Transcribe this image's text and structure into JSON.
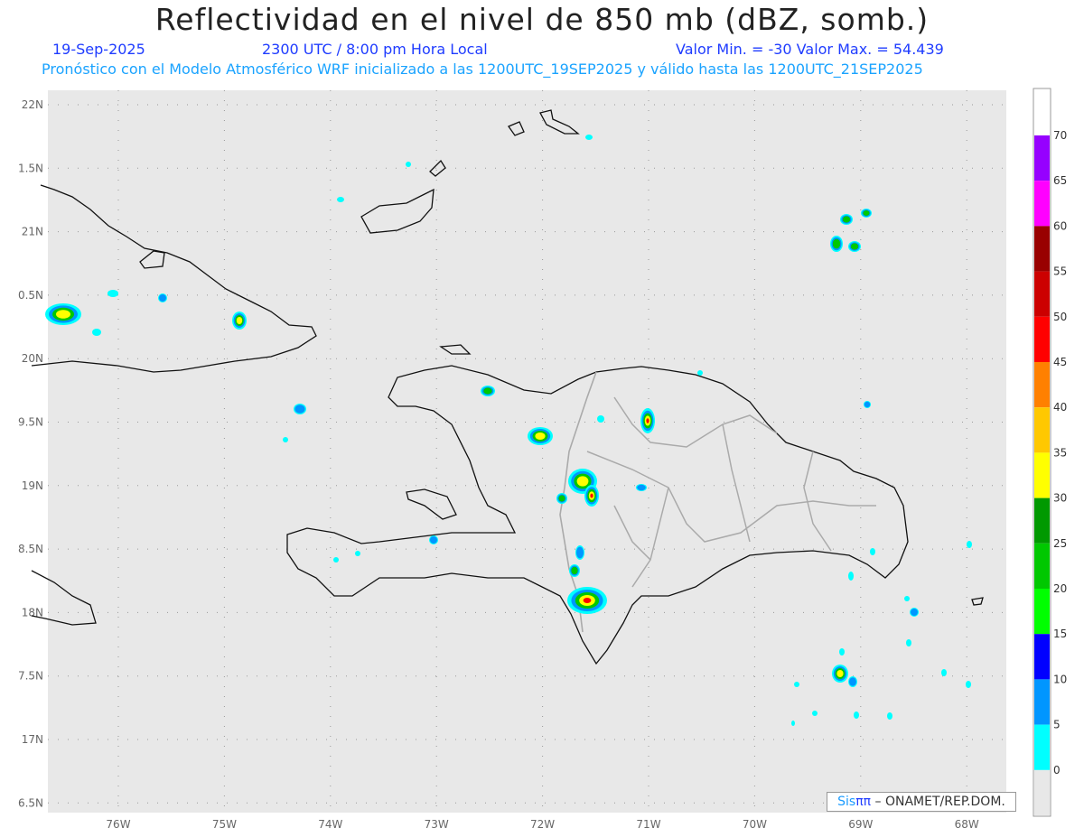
{
  "header": {
    "title": "Reflectividad en el nivel de 850 mb (dBZ, somb.)",
    "date": "19-Sep-2025",
    "time": "2300 UTC / 8:00 pm Hora Local",
    "minmax": "Valor Min. = -30  Valor Max. = 54.439",
    "forecast": "Pronóstico con el Modelo Atmosférico WRF inicializado a las 1200UTC_19SEP2025 y válido hasta las  1200UTC_21SEP2025"
  },
  "map": {
    "lon_labels": [
      "76W",
      "75W",
      "74W",
      "73W",
      "72W",
      "71W",
      "70W",
      "69W",
      "68W"
    ],
    "lat_labels": [
      "22N",
      "1.5N",
      "21N",
      "0.5N",
      "20N",
      "9.5N",
      "19N",
      "8.5N",
      "18N",
      "7.5N",
      "17N",
      "6.5N"
    ],
    "background": "#e8e8e8"
  },
  "colorbar": {
    "labels": [
      "70",
      "65",
      "60",
      "55",
      "50",
      "45",
      "40",
      "35",
      "30",
      "25",
      "20",
      "15",
      "10",
      "5",
      "0"
    ],
    "colors": [
      "#9600ff",
      "#ff00ff",
      "#990000",
      "#cc0000",
      "#ff0000",
      "#ff8000",
      "#ffc800",
      "#ffff00",
      "#009900",
      "#00c800",
      "#00ff00",
      "#0000ff",
      "#0096ff",
      "#00ffff"
    ],
    "below": "#e8e8e8"
  },
  "logo": {
    "sis": "Sis",
    "pi": "ππ",
    "rest": "– ONAMET/REP.DOM."
  }
}
